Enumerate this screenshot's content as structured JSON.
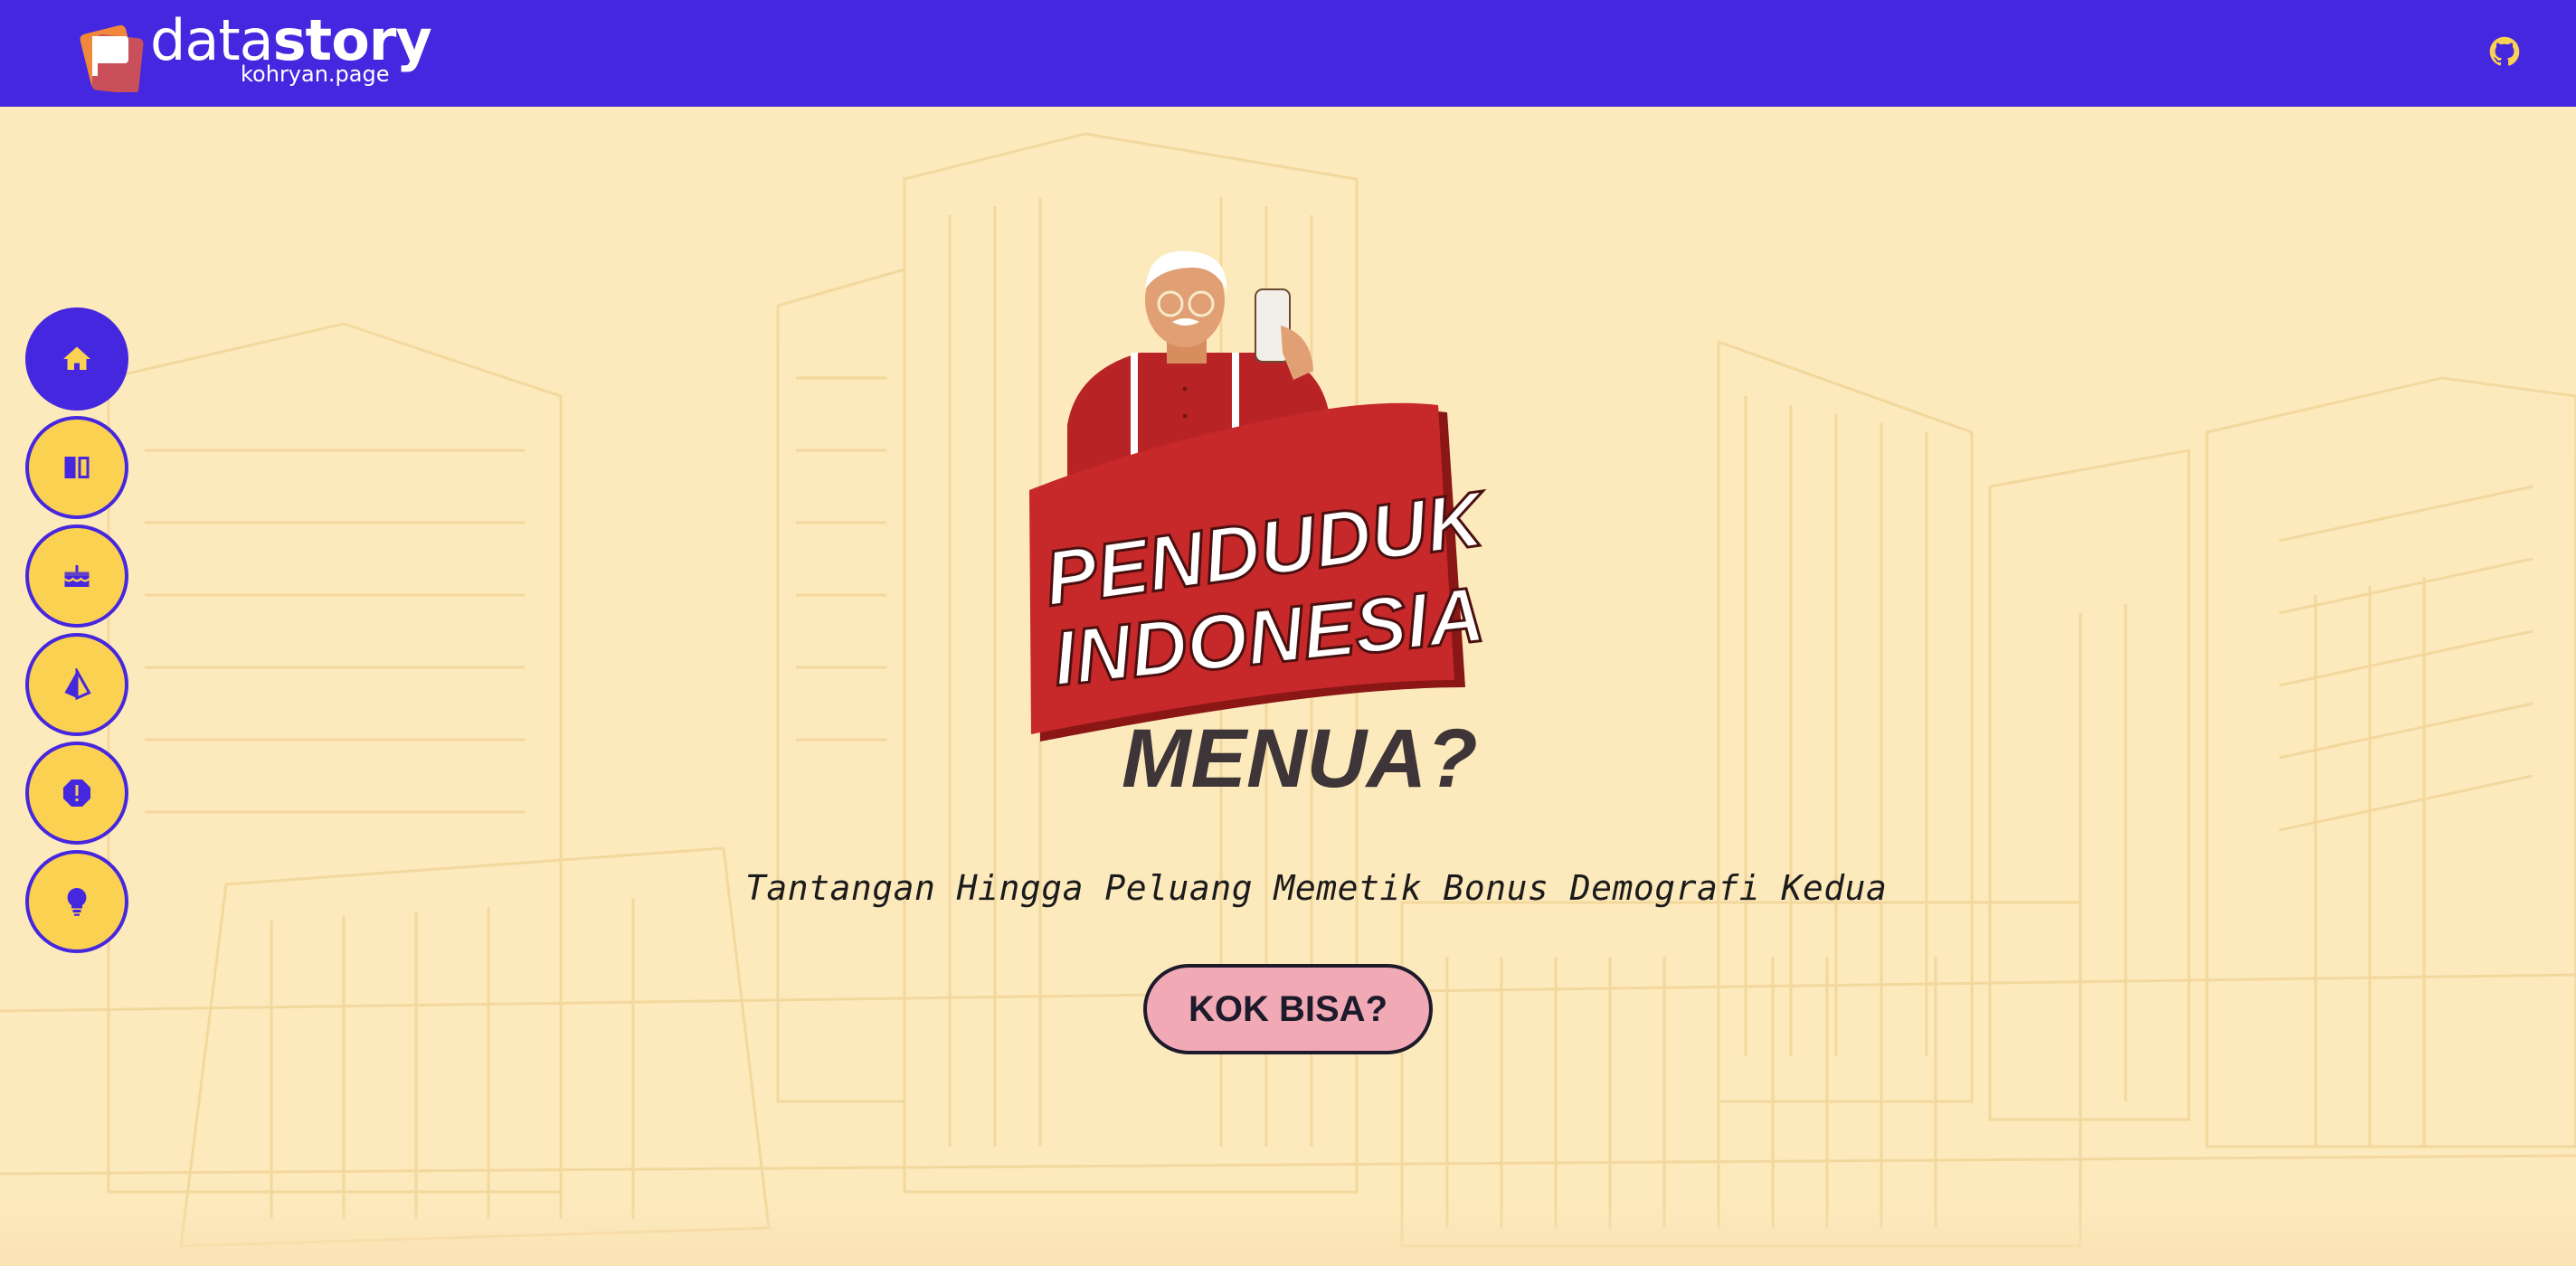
{
  "header": {
    "brand_light": "data",
    "brand_bold": "story",
    "brand_sub": "kohryan.page",
    "github_icon": "github-icon"
  },
  "nav": {
    "items": [
      {
        "name": "home",
        "icon": "home-icon",
        "active": true
      },
      {
        "name": "book",
        "icon": "book-icon",
        "active": false
      },
      {
        "name": "cake",
        "icon": "cake-icon",
        "active": false
      },
      {
        "name": "prism",
        "icon": "prism-icon",
        "active": false
      },
      {
        "name": "alert",
        "icon": "alert-octagon-icon",
        "active": false
      },
      {
        "name": "idea",
        "icon": "lightbulb-icon",
        "active": false
      }
    ]
  },
  "hero": {
    "title_line1": "PENDUDUK",
    "title_line2": "INDONESIA",
    "title_line3": "MENUA?",
    "subtitle": "Tantangan Hingga Peluang Memetik Bonus Demografi Kedua",
    "cta_label": "KOK BISA?"
  },
  "colors": {
    "header_bg": "#4527df",
    "page_bg": "#fce9bc",
    "nav_fill": "#fbd152",
    "banner_red": "#c7282a",
    "cta_bg": "#f2a9b6",
    "github_icon": "#fbd152"
  }
}
